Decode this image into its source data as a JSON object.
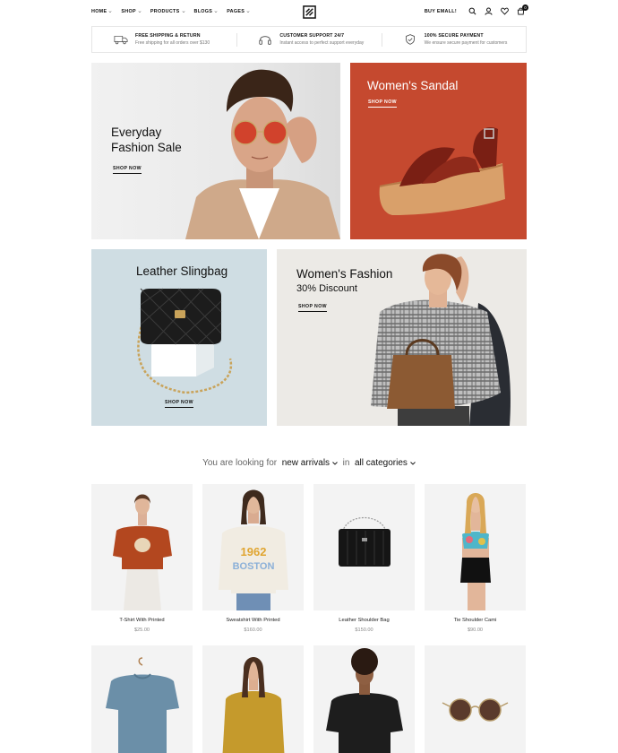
{
  "header": {
    "nav": [
      {
        "label": "HOME"
      },
      {
        "label": "SHOP"
      },
      {
        "label": "PRODUCTS"
      },
      {
        "label": "BLOGS"
      },
      {
        "label": "PAGES"
      }
    ],
    "buy_label": "BUY EMALL!",
    "cart_count": "0",
    "icons": [
      "search-icon",
      "user-icon",
      "heart-icon",
      "cart-icon"
    ]
  },
  "features": [
    {
      "icon": "truck-icon",
      "title": "FREE SHIPPING & RETURN",
      "subtitle": "Free shipping for all orders over $130"
    },
    {
      "icon": "headphones-icon",
      "title": "CUSTOMER SUPPORT 24/7",
      "subtitle": "Instant access to perfect support everyday"
    },
    {
      "icon": "shield-check-icon",
      "title": "100% SECURE PAYMENT",
      "subtitle": "We ensure secure payment for customers"
    }
  ],
  "banners": [
    {
      "title": "Everyday\nFashion Sale",
      "cta": "SHOP NOW"
    },
    {
      "title": "Women's Sandal",
      "cta": "SHOP NOW"
    },
    {
      "title": "Leather Slingbag",
      "cta": "SHOP NOW"
    },
    {
      "title": "Women's Fashion",
      "subtitle": "30% Discount",
      "cta": "SHOP NOW"
    }
  ],
  "filter": {
    "prefix": "You are looking for",
    "value1": "new arrivals",
    "middle": "in",
    "value2": "all categories"
  },
  "products": [
    {
      "name": "T-Shirt With Printed",
      "price": "$25.00"
    },
    {
      "name": "Sweatshirt With Printed",
      "price": "$160.00"
    },
    {
      "name": "Leather Shoulder Bag",
      "price": "$150.00"
    },
    {
      "name": "Tie Shoulder Cami",
      "price": "$90.00"
    }
  ],
  "colors": {
    "accent_banner": "#c5492f",
    "sling_banner": "#cfdde3"
  }
}
